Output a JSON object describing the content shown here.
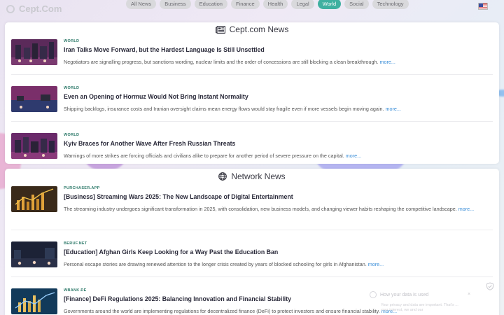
{
  "header": {
    "logo_text": "Cept.Com",
    "categories": [
      "All News",
      "Business",
      "Education",
      "Finance",
      "Health",
      "Legal",
      "World",
      "Social",
      "Technology"
    ],
    "active_category": "World",
    "flag_icon": "us-flag-icon"
  },
  "cept_news": {
    "title": "Cept.com News",
    "icon": "newspaper-icon",
    "items": [
      {
        "source": "WORLD",
        "title": "Iran Talks Move Forward, but the Hardest Language Is Still Unsettled",
        "desc": "Negotiators are signalling progress, but sanctions wording, nuclear limits and the order of concessions are still blocking a clean breakthrough.",
        "more": "more..."
      },
      {
        "source": "WORLD",
        "title": "Even an Opening of Hormuz Would Not Bring Instant Normality",
        "desc": "Shipping backlogs, insurance costs and Iranian oversight claims mean energy flows would stay fragile even if more vessels begin moving again.",
        "more": "more..."
      },
      {
        "source": "WORLD",
        "title": "Kyiv Braces for Another Wave After Fresh Russian Threats",
        "desc": "Warnings of more strikes are forcing officials and civilians alike to prepare for another period of severe pressure on the capital.",
        "more": "more..."
      }
    ]
  },
  "network_news": {
    "title": "Network News",
    "icon": "globe-icon",
    "items": [
      {
        "source": "PURCHASER.APP",
        "title": "[Business] Streaming Wars 2025: The New Landscape of Digital Entertainment",
        "desc": "The streaming industry undergoes significant transformation in 2025, with consolidation, new business models, and changing viewer habits reshaping the competitive landscape.",
        "more": "more..."
      },
      {
        "source": "BERUF.NET",
        "title": "[Education] Afghan Girls Keep Looking for a Way Past the Education Ban",
        "desc": "Personal escape stories are drawing renewed attention to the longer crisis created by years of blocked schooling for girls in Afghanistan.",
        "more": "more..."
      },
      {
        "source": "WBANK.DE",
        "title": "[Finance] DeFi Regulations 2025: Balancing Innovation and Financial Stability",
        "desc": "Governments around the world are implementing regulations for decentralized finance (DeFi) to protect investors and ensure financial stability.",
        "more": "more..."
      }
    ]
  },
  "privacy": {
    "title": "How your data is used",
    "close": "×",
    "text": "Your privacy and data are important. That's ... your interest, we and our"
  },
  "colors": {
    "accent": "#3fb0a0",
    "link": "#3a8ed8",
    "source": "#2e7a6a"
  }
}
